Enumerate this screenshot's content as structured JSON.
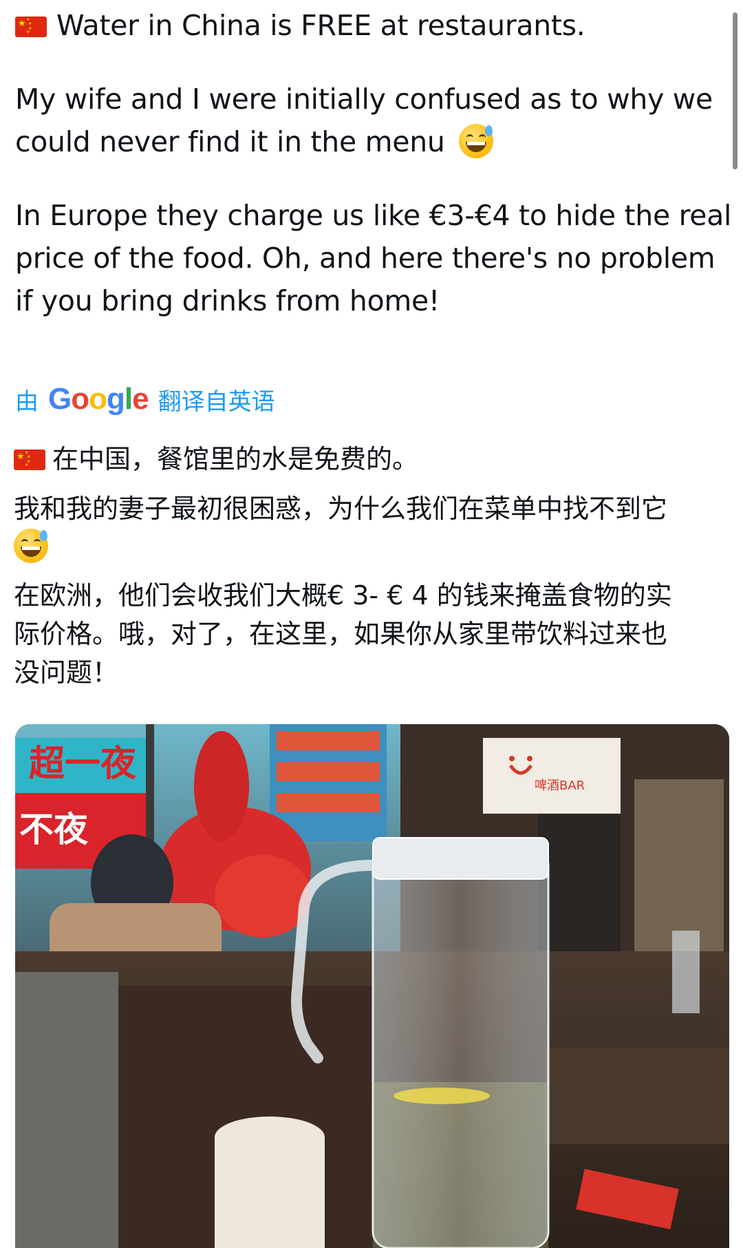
{
  "post": {
    "title_line": "Water in China is FREE at restaurants.",
    "para2_line1": "My wife and I were initially confused as to why we",
    "para2_line2": "could never find it in the menu",
    "para3_line1": "In Europe they charge us like €3-€4 to hide the real",
    "para3_line2": "price of the food. Oh, and here there's no problem",
    "para3_line3": "if you bring drinks from home!"
  },
  "translation": {
    "prefix": "由",
    "google": "Google",
    "suffix": "翻译自英语"
  },
  "translated": {
    "line1": "在中国，餐馆里的水是免费的。",
    "line2": "我和我的妻子最初很困惑，为什么我们在菜单中找不到它",
    "line4": "在欧洲，他们会收我们大概€ 3- € 4 的钱来掩盖食物的实",
    "line5": "际价格。哦，对了，在这里，如果你从家里带饮料过来也",
    "line6": "没问题！"
  },
  "photo": {
    "sign": "啤酒BAR"
  },
  "icons": {
    "flag": "china-flag-icon",
    "emoji": "grinning-face-with-sweat-icon"
  },
  "colors": {
    "link": "#1d9bf0",
    "text": "#0f1419",
    "flag_red": "#de2910",
    "flag_star": "#ffde00"
  }
}
